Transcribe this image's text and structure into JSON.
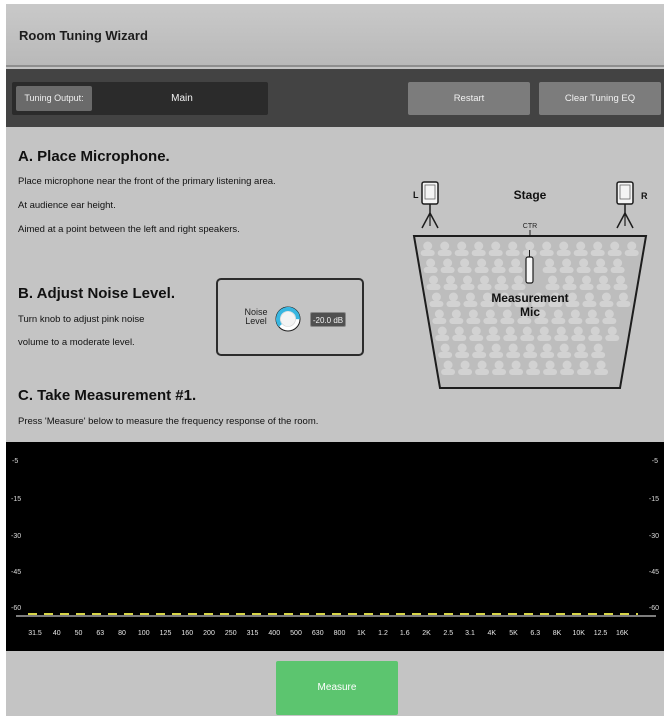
{
  "window": {
    "title": "Room Tuning Wizard"
  },
  "toolbar": {
    "tuning_output_label": "Tuning Output:",
    "tuning_output_value": "Main",
    "restart_label": "Restart",
    "clear_eq_label": "Clear Tuning EQ"
  },
  "section_a": {
    "heading": "A. Place Microphone.",
    "lines": [
      "Place microphone near the front of the primary listening area.",
      "At audience ear height.",
      "Aimed at a point between the left and right speakers."
    ]
  },
  "section_b": {
    "heading": "B. Adjust Noise Level.",
    "lines": [
      "Turn knob to adjust pink noise",
      "volume to a moderate level."
    ],
    "knob_label_line1": "Noise",
    "knob_label_line2": "Level",
    "noise_value": "-20.0 dB",
    "knob_level": 0.85
  },
  "section_c": {
    "heading": "C. Take Measurement #1.",
    "line": "Press 'Measure' below to measure the frequency response of the room."
  },
  "stage": {
    "left_label": "L",
    "right_label": "R",
    "stage_label": "Stage",
    "center_label": "CTR",
    "mic_label_line1": "Measurement",
    "mic_label_line2": "Mic"
  },
  "graph": {
    "y_ticks": [
      "-5",
      "-15",
      "-30",
      "-45",
      "-60"
    ],
    "x_ticks": [
      "31.5",
      "40",
      "50",
      "63",
      "80",
      "100",
      "125",
      "160",
      "200",
      "250",
      "315",
      "400",
      "500",
      "630",
      "800",
      "1K",
      "1.2",
      "1.6",
      "2K",
      "2.5",
      "3.1",
      "4K",
      "5K",
      "6.3",
      "8K",
      "10K",
      "12.5",
      "16K"
    ],
    "trace_color": "#d7d447"
  },
  "footer": {
    "measure_label": "Measure",
    "measure_color": "#5cc56f"
  },
  "colors": {
    "knob_ring": "#38b6e0",
    "background": "#c4c4c4",
    "toolbar": "#434343"
  }
}
